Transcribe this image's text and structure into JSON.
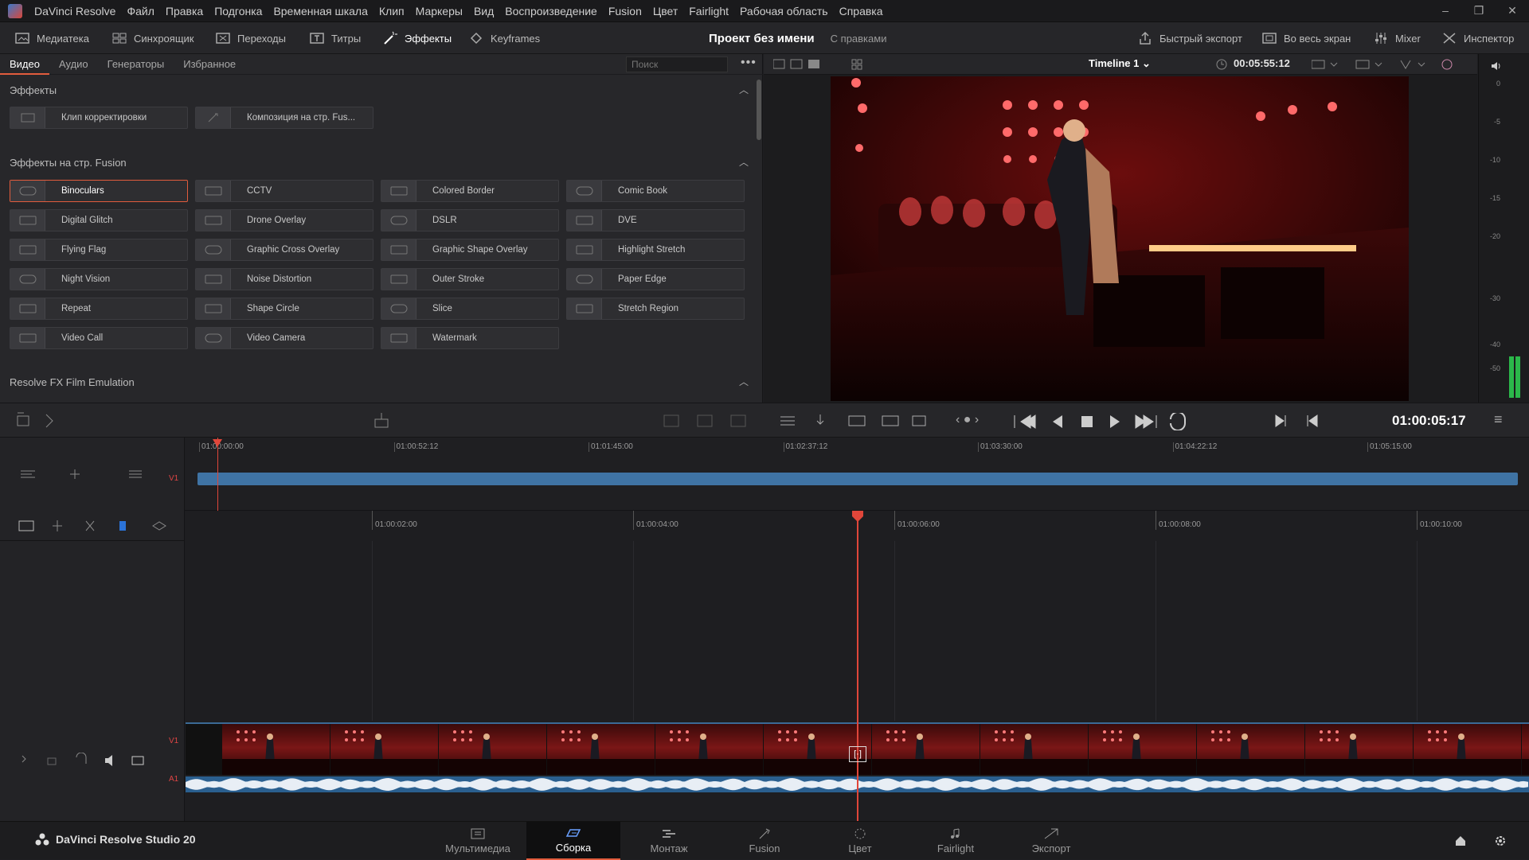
{
  "menubar": {
    "app_name": "DaVinci Resolve",
    "items": [
      "Файл",
      "Правка",
      "Подгонка",
      "Временная шкала",
      "Клип",
      "Маркеры",
      "Вид",
      "Воспроизведение",
      "Fusion",
      "Цвет",
      "Fairlight",
      "Рабочая область",
      "Справка"
    ]
  },
  "toolbar": {
    "media": "Медиатека",
    "sync": "Синхроящик",
    "transitions": "Переходы",
    "titles": "Титры",
    "effects": "Эффекты",
    "keyframes": "Keyframes",
    "project_title": "Проект без имени",
    "project_status": "С правками",
    "quick_export": "Быстрый экспорт",
    "fullscreen": "Во весь экран",
    "mixer": "Mixer",
    "inspector": "Инспектор"
  },
  "fx": {
    "tabs": [
      "Видео",
      "Аудио",
      "Генераторы",
      "Избранное"
    ],
    "active_tab": "Видео",
    "search_placeholder": "Поиск",
    "section_effects": "Эффекты",
    "effects_items": [
      "Клип корректировки",
      "Композиция на стр. Fus..."
    ],
    "section_fusion": "Эффекты на стр. Fusion",
    "fusion_items": [
      "Binoculars",
      "CCTV",
      "Colored Border",
      "Comic Book",
      "Digital Glitch",
      "Drone Overlay",
      "DSLR",
      "DVE",
      "Flying Flag",
      "Graphic Cross Overlay",
      "Graphic Shape Overlay",
      "Highlight Stretch",
      "Night Vision",
      "Noise Distortion",
      "Outer Stroke",
      "Paper Edge",
      "Repeat",
      "Shape Circle",
      "Slice",
      "Stretch Region",
      "Video Call",
      "Video Camera",
      "Watermark"
    ],
    "selected": "Binoculars",
    "section_film": "Resolve FX Film Emulation"
  },
  "viewer": {
    "timeline_name": "Timeline 1",
    "duration_tc": "00:05:55:12",
    "meter_labels": [
      "0",
      "-5",
      "-10",
      "-15",
      "-20",
      "-30",
      "-40",
      "-50"
    ]
  },
  "transport": {
    "timecode": "01:00:05:17"
  },
  "upper_timeline": {
    "ruler": [
      "01:00:00:00",
      "01:00:52:12",
      "01:01:45:00",
      "01:02:37:12",
      "01:03:30:00",
      "01:04:22:12",
      "01:05:15:00"
    ],
    "track": "V1"
  },
  "lower_timeline": {
    "ruler": [
      "01:00:02:00",
      "01:00:04:00",
      "01:00:06:00",
      "01:00:08:00",
      "01:00:10:00"
    ],
    "video_track": "V1",
    "audio_track": "A1"
  },
  "pages": {
    "brand": "DaVinci Resolve Studio 20",
    "items": [
      "Мультимедиа",
      "Сборка",
      "Монтаж",
      "Fusion",
      "Цвет",
      "Fairlight",
      "Экспорт"
    ],
    "active": "Сборка"
  },
  "colors": {
    "accent": "#e25c3d",
    "clip_blue": "#3f73a4",
    "playhead": "#e0463a"
  }
}
